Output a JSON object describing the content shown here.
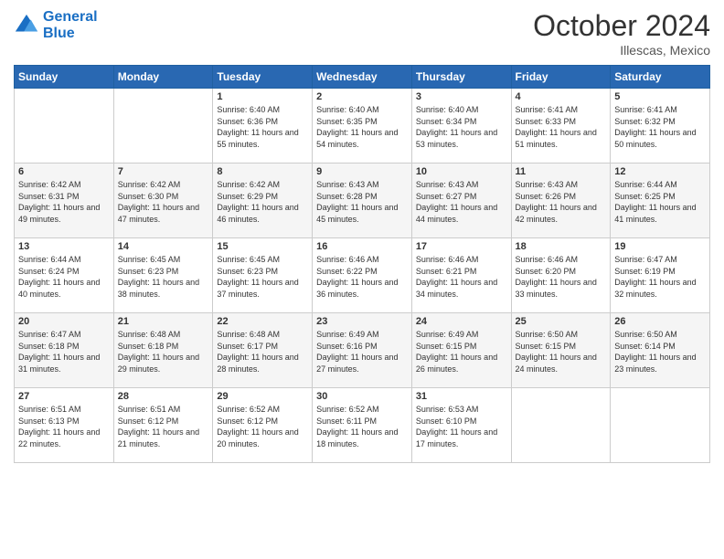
{
  "header": {
    "logo_line1": "General",
    "logo_line2": "Blue",
    "month": "October 2024",
    "location": "Illescas, Mexico"
  },
  "days_of_week": [
    "Sunday",
    "Monday",
    "Tuesday",
    "Wednesday",
    "Thursday",
    "Friday",
    "Saturday"
  ],
  "weeks": [
    [
      {
        "day": "",
        "info": ""
      },
      {
        "day": "",
        "info": ""
      },
      {
        "day": "1",
        "info": "Sunrise: 6:40 AM\nSunset: 6:36 PM\nDaylight: 11 hours and 55 minutes."
      },
      {
        "day": "2",
        "info": "Sunrise: 6:40 AM\nSunset: 6:35 PM\nDaylight: 11 hours and 54 minutes."
      },
      {
        "day": "3",
        "info": "Sunrise: 6:40 AM\nSunset: 6:34 PM\nDaylight: 11 hours and 53 minutes."
      },
      {
        "day": "4",
        "info": "Sunrise: 6:41 AM\nSunset: 6:33 PM\nDaylight: 11 hours and 51 minutes."
      },
      {
        "day": "5",
        "info": "Sunrise: 6:41 AM\nSunset: 6:32 PM\nDaylight: 11 hours and 50 minutes."
      }
    ],
    [
      {
        "day": "6",
        "info": "Sunrise: 6:42 AM\nSunset: 6:31 PM\nDaylight: 11 hours and 49 minutes."
      },
      {
        "day": "7",
        "info": "Sunrise: 6:42 AM\nSunset: 6:30 PM\nDaylight: 11 hours and 47 minutes."
      },
      {
        "day": "8",
        "info": "Sunrise: 6:42 AM\nSunset: 6:29 PM\nDaylight: 11 hours and 46 minutes."
      },
      {
        "day": "9",
        "info": "Sunrise: 6:43 AM\nSunset: 6:28 PM\nDaylight: 11 hours and 45 minutes."
      },
      {
        "day": "10",
        "info": "Sunrise: 6:43 AM\nSunset: 6:27 PM\nDaylight: 11 hours and 44 minutes."
      },
      {
        "day": "11",
        "info": "Sunrise: 6:43 AM\nSunset: 6:26 PM\nDaylight: 11 hours and 42 minutes."
      },
      {
        "day": "12",
        "info": "Sunrise: 6:44 AM\nSunset: 6:25 PM\nDaylight: 11 hours and 41 minutes."
      }
    ],
    [
      {
        "day": "13",
        "info": "Sunrise: 6:44 AM\nSunset: 6:24 PM\nDaylight: 11 hours and 40 minutes."
      },
      {
        "day": "14",
        "info": "Sunrise: 6:45 AM\nSunset: 6:23 PM\nDaylight: 11 hours and 38 minutes."
      },
      {
        "day": "15",
        "info": "Sunrise: 6:45 AM\nSunset: 6:23 PM\nDaylight: 11 hours and 37 minutes."
      },
      {
        "day": "16",
        "info": "Sunrise: 6:46 AM\nSunset: 6:22 PM\nDaylight: 11 hours and 36 minutes."
      },
      {
        "day": "17",
        "info": "Sunrise: 6:46 AM\nSunset: 6:21 PM\nDaylight: 11 hours and 34 minutes."
      },
      {
        "day": "18",
        "info": "Sunrise: 6:46 AM\nSunset: 6:20 PM\nDaylight: 11 hours and 33 minutes."
      },
      {
        "day": "19",
        "info": "Sunrise: 6:47 AM\nSunset: 6:19 PM\nDaylight: 11 hours and 32 minutes."
      }
    ],
    [
      {
        "day": "20",
        "info": "Sunrise: 6:47 AM\nSunset: 6:18 PM\nDaylight: 11 hours and 31 minutes."
      },
      {
        "day": "21",
        "info": "Sunrise: 6:48 AM\nSunset: 6:18 PM\nDaylight: 11 hours and 29 minutes."
      },
      {
        "day": "22",
        "info": "Sunrise: 6:48 AM\nSunset: 6:17 PM\nDaylight: 11 hours and 28 minutes."
      },
      {
        "day": "23",
        "info": "Sunrise: 6:49 AM\nSunset: 6:16 PM\nDaylight: 11 hours and 27 minutes."
      },
      {
        "day": "24",
        "info": "Sunrise: 6:49 AM\nSunset: 6:15 PM\nDaylight: 11 hours and 26 minutes."
      },
      {
        "day": "25",
        "info": "Sunrise: 6:50 AM\nSunset: 6:15 PM\nDaylight: 11 hours and 24 minutes."
      },
      {
        "day": "26",
        "info": "Sunrise: 6:50 AM\nSunset: 6:14 PM\nDaylight: 11 hours and 23 minutes."
      }
    ],
    [
      {
        "day": "27",
        "info": "Sunrise: 6:51 AM\nSunset: 6:13 PM\nDaylight: 11 hours and 22 minutes."
      },
      {
        "day": "28",
        "info": "Sunrise: 6:51 AM\nSunset: 6:12 PM\nDaylight: 11 hours and 21 minutes."
      },
      {
        "day": "29",
        "info": "Sunrise: 6:52 AM\nSunset: 6:12 PM\nDaylight: 11 hours and 20 minutes."
      },
      {
        "day": "30",
        "info": "Sunrise: 6:52 AM\nSunset: 6:11 PM\nDaylight: 11 hours and 18 minutes."
      },
      {
        "day": "31",
        "info": "Sunrise: 6:53 AM\nSunset: 6:10 PM\nDaylight: 11 hours and 17 minutes."
      },
      {
        "day": "",
        "info": ""
      },
      {
        "day": "",
        "info": ""
      }
    ]
  ]
}
